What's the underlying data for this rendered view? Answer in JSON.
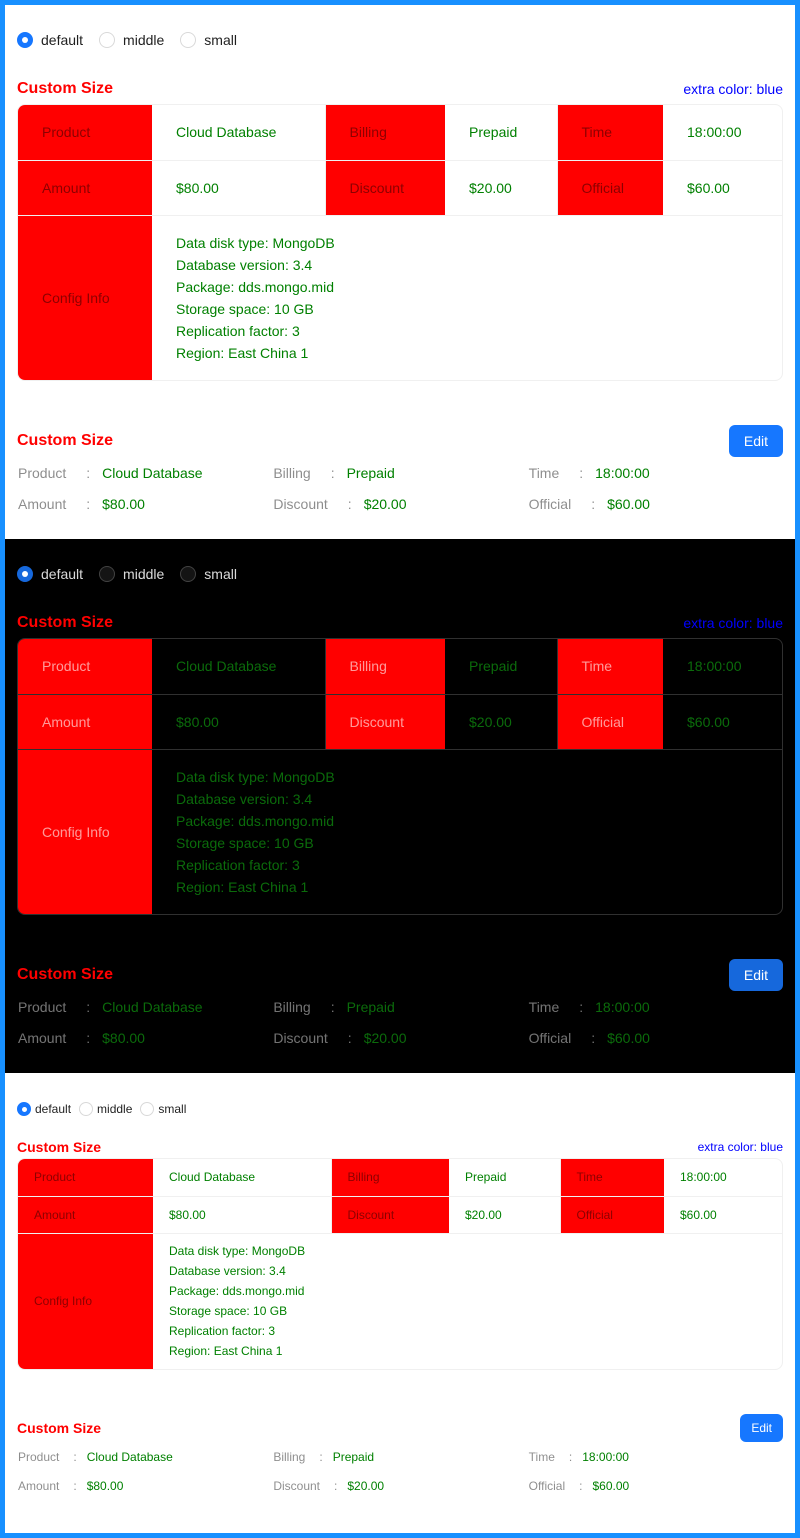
{
  "radio_options": [
    "default",
    "middle",
    "small"
  ],
  "selected_size": "default",
  "title": "Custom Size",
  "extra": "extra color: blue",
  "edit_label": "Edit",
  "colon": ":",
  "items": [
    {
      "label": "Product",
      "value": "Cloud Database"
    },
    {
      "label": "Billing",
      "value": "Prepaid"
    },
    {
      "label": "Time",
      "value": "18:00:00"
    },
    {
      "label": "Amount",
      "value": "$80.00"
    },
    {
      "label": "Discount",
      "value": "$20.00"
    },
    {
      "label": "Official",
      "value": "$60.00"
    }
  ],
  "config": {
    "label": "Config Info",
    "lines": [
      "Data disk type: MongoDB",
      "Database version: 3.4",
      "Package: dds.mongo.mid",
      "Storage space: 10 GB",
      "Replication factor: 3",
      "Region: East China 1"
    ]
  },
  "colors": {
    "label_bg": "#ff0000",
    "value": "#008000",
    "title": "#ff0000",
    "extra": "#0000ff",
    "accent": "#1677ff",
    "frame": "#1890ff"
  }
}
